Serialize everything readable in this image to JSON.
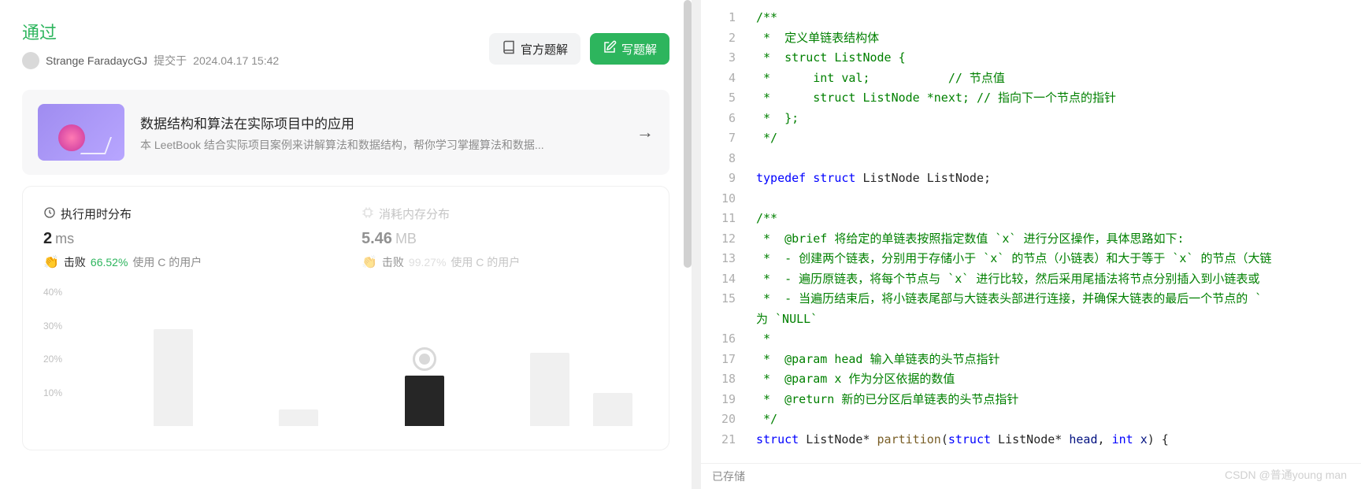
{
  "submission": {
    "status": "通过",
    "user": "Strange FaradaycGJ",
    "submit_label": "提交于",
    "timestamp": "2024.04.17 15:42"
  },
  "buttons": {
    "official": "官方题解",
    "write": "写题解"
  },
  "promo": {
    "title": "数据结构和算法在实际项目中的应用",
    "desc": "本 LeetBook 结合实际项目案例来讲解算法和数据结构，帮你学习掌握算法和数据..."
  },
  "stats": {
    "time": {
      "title": "执行用时分布",
      "value": "2",
      "unit": "ms",
      "beat_label": "击败",
      "pct": "66.52%",
      "beat_suffix": "使用 C 的用户"
    },
    "memory": {
      "title": "消耗内存分布",
      "value": "5.46",
      "unit": "MB",
      "beat_label": "击败",
      "pct": "99.27%",
      "beat_suffix": "使用 C 的用户"
    }
  },
  "chart_data": {
    "type": "bar",
    "ylabel": "percent",
    "ylim": [
      0,
      40
    ],
    "y_ticks": [
      "40%",
      "30%",
      "20%",
      "10%"
    ],
    "categories": [
      "b1",
      "b2",
      "b3",
      "b4",
      "b5",
      "my",
      "b7",
      "b8",
      "b9"
    ],
    "values": [
      0,
      29,
      0,
      5,
      0,
      15,
      0,
      22,
      10
    ],
    "highlight_index": 5
  },
  "code": {
    "saved": "已存储",
    "lines": [
      {
        "n": 1,
        "t": "comment",
        "text": "/**"
      },
      {
        "n": 2,
        "t": "comment",
        "text": " *  定义单链表结构体"
      },
      {
        "n": 3,
        "t": "comment",
        "text": " *  struct ListNode {"
      },
      {
        "n": 4,
        "t": "comment",
        "text": " *      int val;           // 节点值"
      },
      {
        "n": 5,
        "t": "comment",
        "text": " *      struct ListNode *next; // 指向下一个节点的指针"
      },
      {
        "n": 6,
        "t": "comment",
        "text": " *  };"
      },
      {
        "n": 7,
        "t": "comment",
        "text": " */"
      },
      {
        "n": 8,
        "t": "blank",
        "text": ""
      },
      {
        "n": 9,
        "t": "typedef",
        "kw1": "typedef",
        "kw2": "struct",
        "rest": " ListNode ListNode;"
      },
      {
        "n": 10,
        "t": "blank",
        "text": ""
      },
      {
        "n": 11,
        "t": "comment",
        "text": "/**"
      },
      {
        "n": 12,
        "t": "comment",
        "text": " *  @brief 将给定的单链表按照指定数值 `x` 进行分区操作，具体思路如下:"
      },
      {
        "n": 13,
        "t": "comment",
        "text": " *  - 创建两个链表，分别用于存储小于 `x` 的节点（小链表）和大于等于 `x` 的节点（大链"
      },
      {
        "n": 14,
        "t": "comment",
        "text": " *  - 遍历原链表，将每个节点与 `x` 进行比较，然后采用尾插法将节点分别插入到小链表或"
      },
      {
        "n": 15,
        "t": "comment",
        "text": " *  - 当遍历结束后，将小链表尾部与大链表头部进行连接，并确保大链表的最后一个节点的 `"
      },
      {
        "n": "",
        "t": "comment",
        "text": "为 `NULL`"
      },
      {
        "n": 16,
        "t": "comment",
        "text": " *"
      },
      {
        "n": 17,
        "t": "comment",
        "text": " *  @param head 输入单链表的头节点指针"
      },
      {
        "n": 18,
        "t": "comment",
        "text": " *  @param x 作为分区依据的数值"
      },
      {
        "n": 19,
        "t": "comment",
        "text": " *  @return 新的已分区后单链表的头节点指针"
      },
      {
        "n": 20,
        "t": "comment",
        "text": " */"
      },
      {
        "n": 21,
        "t": "func",
        "kw": "struct",
        "type": " ListNode* ",
        "fn": "partition",
        "args_open": "(",
        "kw2": "struct",
        "mid": " ListNode* ",
        "id1": "head",
        "sep": ", ",
        "kw3": "int",
        "sp": " ",
        "id2": "x",
        "close": ") {"
      }
    ]
  },
  "watermark": "CSDN @普通young man"
}
